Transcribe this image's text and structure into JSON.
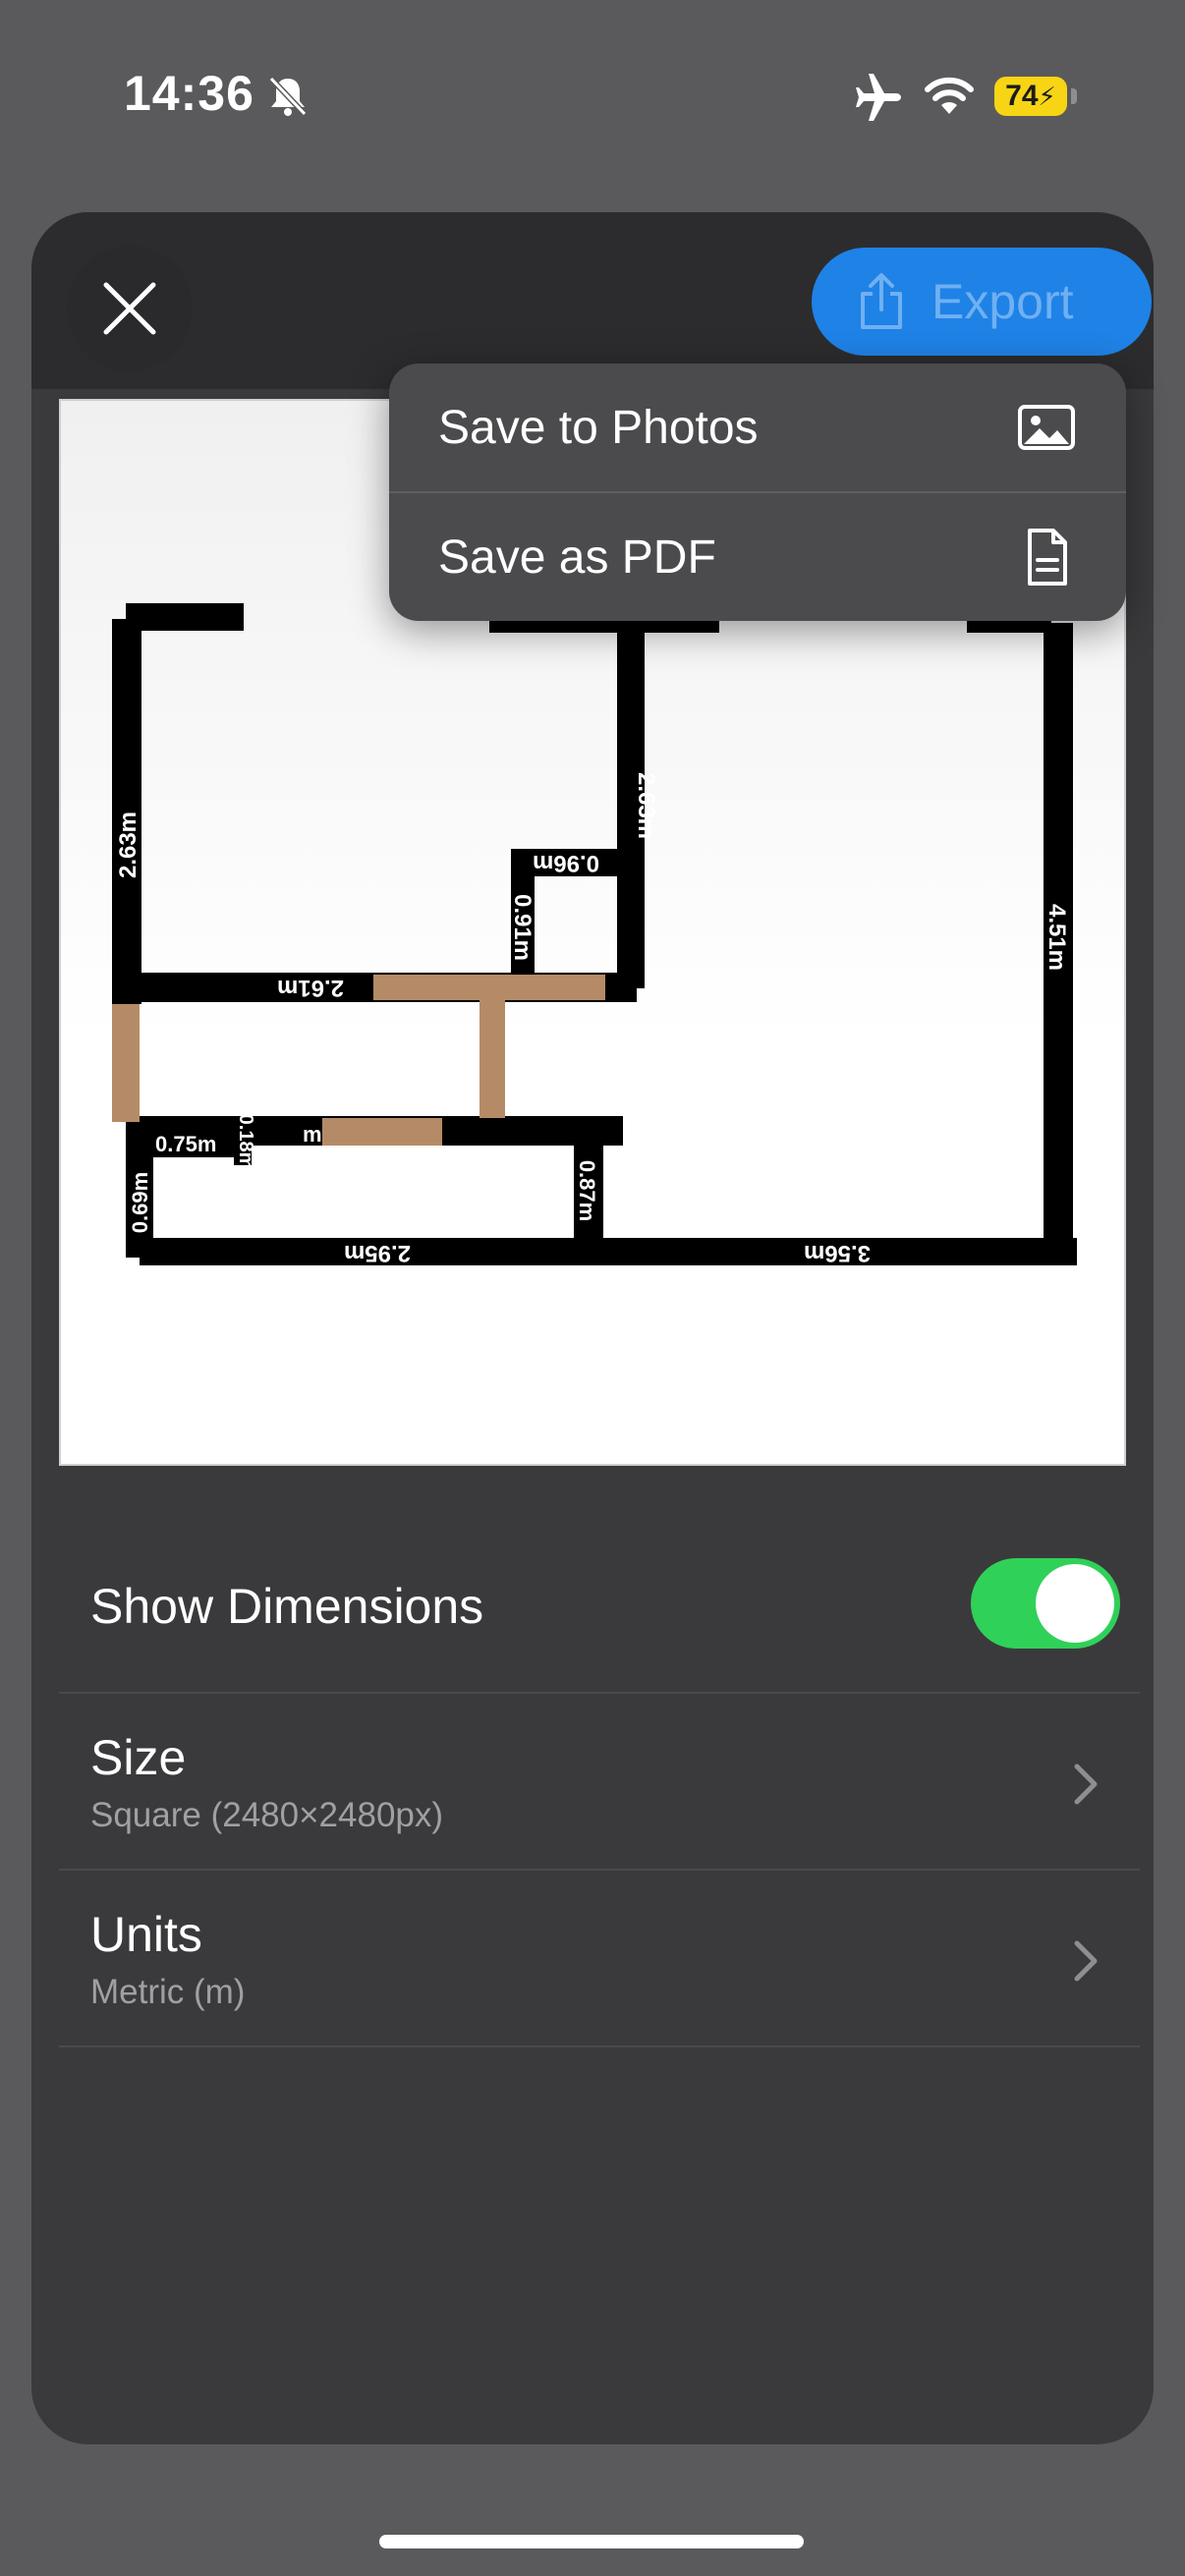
{
  "status": {
    "time": "14:36",
    "battery": "74"
  },
  "header": {
    "export_label": "Export"
  },
  "export_menu": {
    "items": [
      {
        "label": "Save to Photos",
        "icon": "photo-icon"
      },
      {
        "label": "Save as PDF",
        "icon": "document-icon"
      }
    ]
  },
  "floor_plan": {
    "dimensions": {
      "left_room_wall": "2.63m",
      "middle_wall": "2.63m",
      "closet_top": "0.96m",
      "closet_side": "0.91m",
      "right_wall": "4.51m",
      "hall_wall": "2.61m",
      "small_top": "0.75m",
      "small_side": "0.18m",
      "small_left": "0.69m",
      "small_right": "0.87m",
      "bottom_left": "2.95m",
      "bottom_right": "3.56m",
      "partial": "m"
    },
    "colors": {
      "wall": "#000000",
      "door": "#b48b66"
    }
  },
  "settings": {
    "show_dimensions": {
      "label": "Show Dimensions",
      "enabled": true
    },
    "size": {
      "label": "Size",
      "value": "Square (2480×2480px)"
    },
    "units": {
      "label": "Units",
      "value": "Metric (m)"
    }
  }
}
